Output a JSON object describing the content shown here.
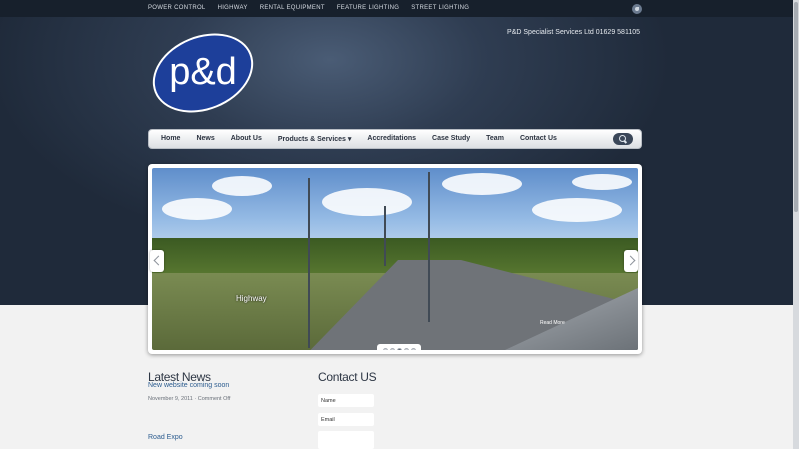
{
  "top_nav": [
    "POWER CONTROL",
    "HIGHWAY",
    "RENTAL EQUIPMENT",
    "FEATURE LIGHTING",
    "STREET LIGHTING"
  ],
  "phone": "P&D Specialist Services Ltd 01629 581105",
  "logo_text": "p&d",
  "main_nav": [
    "Home",
    "News",
    "About Us",
    "Products & Services ▾",
    "Accreditations",
    "Case Study",
    "Team",
    "Contact Us"
  ],
  "slider": {
    "caption": "Highway",
    "read_more": "Read More",
    "slide_count": 5,
    "active_slide": 3
  },
  "latest_news": {
    "title": "Latest News",
    "items": [
      {
        "title": "New website coming soon",
        "date": "November 9, 2011",
        "comments": "Comment Off"
      },
      {
        "title": "Road Expo"
      }
    ]
  },
  "contact": {
    "title": "Contact US",
    "name_placeholder": "Name",
    "email_placeholder": "Email"
  },
  "colors": {
    "accent": "#2c5c8f",
    "logo_blue": "#1d3f9a"
  }
}
